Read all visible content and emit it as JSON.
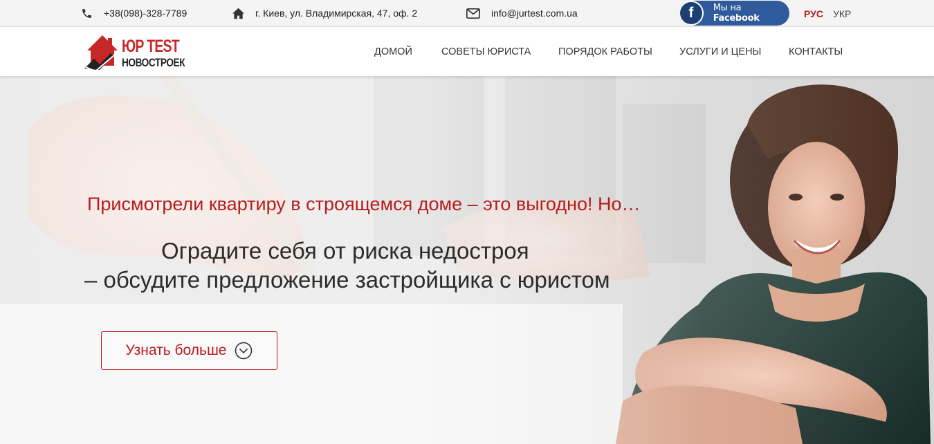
{
  "topbar": {
    "phone": "+38(098)-328-7789",
    "address": "г. Киев, ул. Владимирская, 47, оф. 2",
    "email": "info@jurtest.com.ua",
    "facebook": {
      "prefix": "Мы на",
      "brand": "Facebook",
      "icon": "f"
    },
    "languages": [
      {
        "label": "РУС",
        "active": true
      },
      {
        "label": "УКР",
        "active": false
      }
    ]
  },
  "header": {
    "logo": {
      "line1": "ЮР TEST",
      "line2": "НОВОСТРОЕК"
    },
    "nav": [
      {
        "label": "ДОМОЙ"
      },
      {
        "label": "СОВЕТЫ ЮРИСТА"
      },
      {
        "label": "ПОРЯДОК РАБОТЫ"
      },
      {
        "label": "УСЛУГИ И ЦЕНЫ"
      },
      {
        "label": "КОНТАКТЫ"
      }
    ]
  },
  "hero": {
    "subtitle": "Присмотрели квартиру в строящемся доме – это выгодно! Но…",
    "title_line1": "Оградите себя от риска недостроя",
    "title_line2": "– обсудите предложение застройщика с юристом",
    "cta_label": "Узнать больше"
  },
  "colors": {
    "accent": "#b71c1c",
    "facebook": "#2f5a9b",
    "text": "#2b2b2b"
  },
  "icons": {
    "phone": "phone-icon",
    "address": "home-icon",
    "email": "envelope-icon",
    "cta": "chevron-down-circle-icon"
  }
}
